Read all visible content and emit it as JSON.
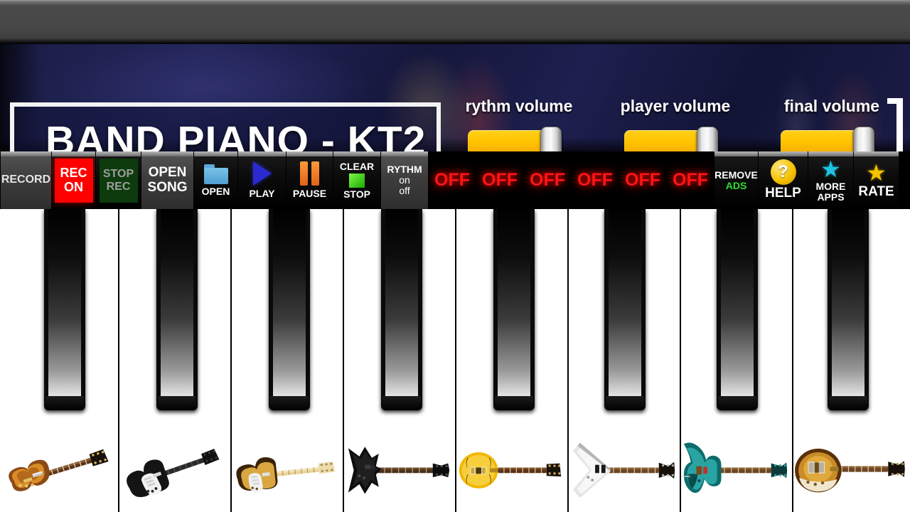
{
  "app": {
    "title": "BAND PIANO - KT2",
    "topbar_color": "#474747",
    "header_bg_color": "#15173a"
  },
  "volumes": [
    {
      "label": "rythm volume",
      "value": 91,
      "ticks": [
        "0",
        "20",
        "40",
        "60",
        "80",
        "100"
      ],
      "fill_color": "#ffc400"
    },
    {
      "label": "player volume",
      "value": 91,
      "ticks": [
        "0",
        "20",
        "40",
        "60",
        "80",
        "100"
      ],
      "fill_color": "#ffc400"
    },
    {
      "label": "final volume",
      "value": 91,
      "ticks": [
        "0",
        "20",
        "40",
        "60",
        "80",
        "100"
      ],
      "fill_color": "#ffc400"
    }
  ],
  "toolbar": {
    "record_label": "RECORD",
    "rec_on_line1": "REC",
    "rec_on_line2": "ON",
    "stop_rec_line1": "STOP",
    "stop_rec_line2": "REC",
    "open_song_line1": "OPEN",
    "open_song_line2": "SONG",
    "open_label": "OPEN",
    "play_label": "PLAY",
    "pause_label": "PAUSE",
    "clear_label": "CLEAR",
    "stop_label": "STOP",
    "rythm_line1": "RYTHM",
    "rythm_line2": "on",
    "rythm_line3": "off",
    "off_buttons": [
      "OFF",
      "OFF",
      "OFF",
      "OFF",
      "OFF",
      "OFF"
    ],
    "remove_label": "REMOVE",
    "ads_label": "ADS",
    "help_label": "HELP",
    "help_icon_glyph": "?",
    "more_line1": "MORE",
    "more_line2": "APPS",
    "rate_label": "RATE",
    "rec_on_color": "#ff0000",
    "stop_rec_color": "#0d3b0d",
    "ads_color": "#2ee02e",
    "off_color": "#ff1414",
    "more_apps_star_color": "#1fc4e0",
    "rate_star_color": "#f5c400"
  },
  "piano": {
    "white_key_count": 8,
    "black_key_count": 8,
    "instruments": [
      {
        "name": "les-paul-sunburst",
        "body": "#8a4a16",
        "body2": "#d98b26",
        "neck": "#5a3318"
      },
      {
        "name": "stratocaster-black-white",
        "body": "#141414",
        "body2": "#f2f2f2",
        "neck": "#2a2a2a"
      },
      {
        "name": "stratocaster-sunburst",
        "body": "#3a2309",
        "body2": "#d9a640",
        "neck": "#e8d49a"
      },
      {
        "name": "metal-spiked-black",
        "body": "#0d0d0d",
        "body2": "#2a2a2a",
        "neck": "#4a3220"
      },
      {
        "name": "semi-hollow-yellow",
        "body": "#f2b705",
        "body2": "#f7cf3d",
        "neck": "#5a3318"
      },
      {
        "name": "flying-v-white",
        "body": "#e6e6e6",
        "body2": "#b5b5b5",
        "neck": "#6b4524"
      },
      {
        "name": "superstrat-teal",
        "body": "#0e6b6b",
        "body2": "#2aa3a3",
        "neck": "#6b4524"
      },
      {
        "name": "hollowbody-sunburst",
        "body": "#5a3008",
        "body2": "#e0a93c",
        "neck": "#6b4524"
      }
    ]
  }
}
